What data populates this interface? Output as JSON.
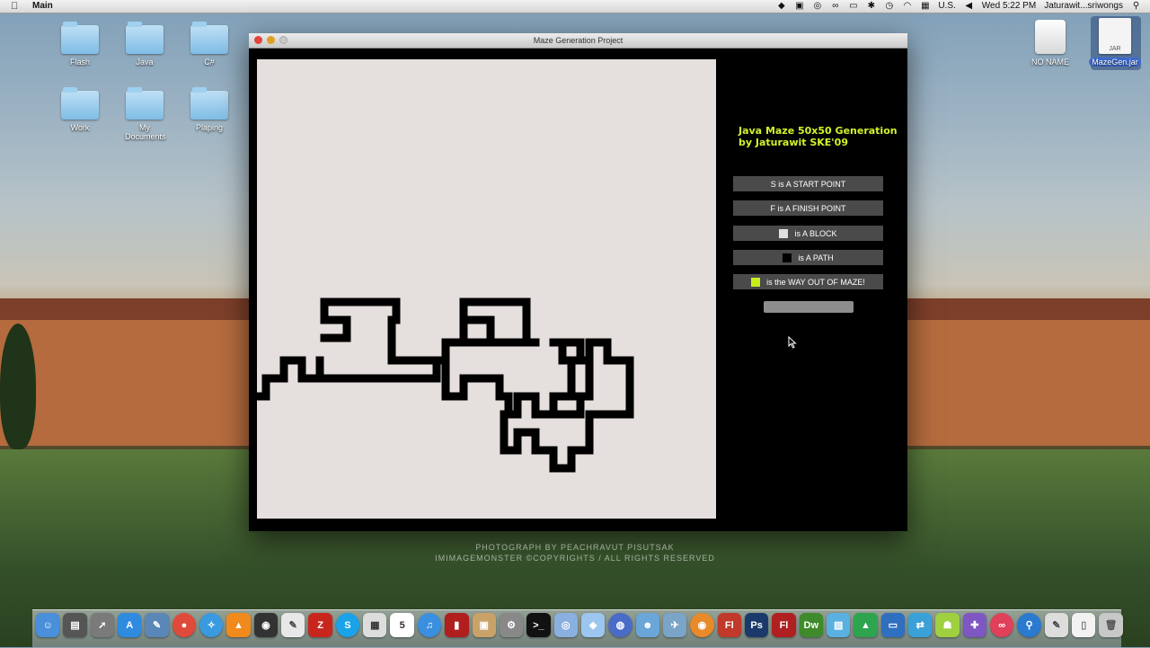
{
  "menubar": {
    "app_name": "Main",
    "locale": "U.S.",
    "clock": "Wed 5:22 PM",
    "user": "Jaturawit...sriwongs"
  },
  "desktop_icons": {
    "flash": "Flash",
    "java": "Java",
    "csharp": "C#",
    "work": "Work",
    "my_documents": "My Documents",
    "playing": "Plaping",
    "no_name": "NO NAME",
    "mazegen_jar": "MazeGen.jar",
    "jar_tag": "JAR"
  },
  "window": {
    "title": "Maze Generation Project"
  },
  "info": {
    "line1": "Java Maze 50x50 Generation",
    "line2": "by Jaturawit SKE'09"
  },
  "legend": {
    "start": "S   is A START POINT",
    "finish": "F   is A FINISH POINT",
    "block": "is A BLOCK",
    "path": "is A PATH",
    "way_out": "is the WAY OUT OF MAZE!"
  },
  "watermark": {
    "line1": "PHOTOGRAPH BY PEACHRAVUT PISUTSAK",
    "line2": "IMIMAGEMONSTER ©COPYRIGHTS / ALL RIGHTS RESERVED"
  },
  "colors": {
    "maze_background": "#e5dfdd",
    "maze_path": "#000000",
    "info_text": "#d4f22a",
    "way_out_swatch": "#c5f01b",
    "block_swatch": "#e0e0e0"
  },
  "dock": {
    "flash_cs": "Fl",
    "photoshop": "Ps",
    "flash": "Fl",
    "dreamweaver": "Dw",
    "calendar_day": "5"
  }
}
